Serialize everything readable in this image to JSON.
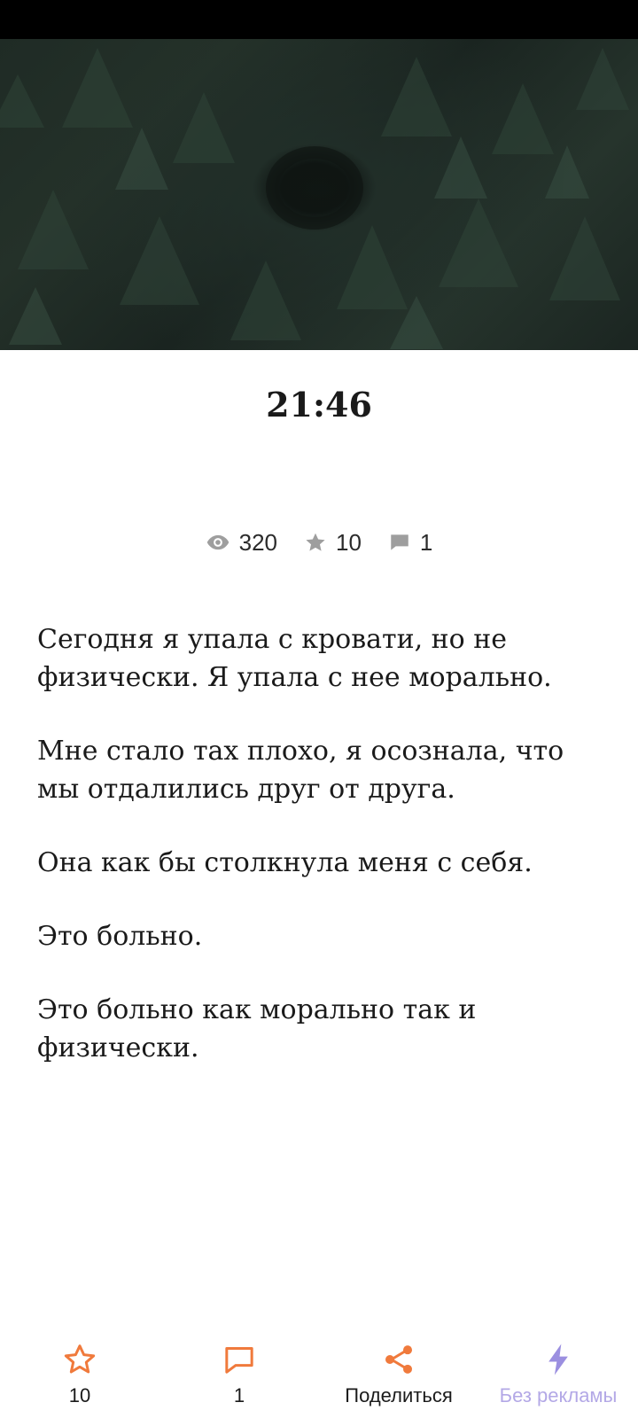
{
  "story": {
    "title": "21:46",
    "stats": {
      "views": "320",
      "likes": "10",
      "comments": "1"
    },
    "paragraphs": [
      "Сегодня я упала с кровати, но не физически. Я упала с нее морально.",
      "Мне стало тах плохо, я осознала, что мы отдалились друг от друга.",
      "Она как бы столкнула меня с себя.",
      "Это больно.",
      "Это больно как морально так и физически."
    ]
  },
  "bottom_bar": {
    "like": {
      "label": "10",
      "icon": "star-outline-icon"
    },
    "comment": {
      "label": "1",
      "icon": "comment-outline-icon"
    },
    "share": {
      "label": "Поделиться",
      "icon": "share-icon"
    },
    "no_ads": {
      "label": "Без рекламы",
      "icon": "lightning-icon"
    }
  },
  "colors": {
    "accent": "#f07a3c",
    "no_ads_accent": "#9b8fe0",
    "muted_icon": "#9e9e9e"
  }
}
